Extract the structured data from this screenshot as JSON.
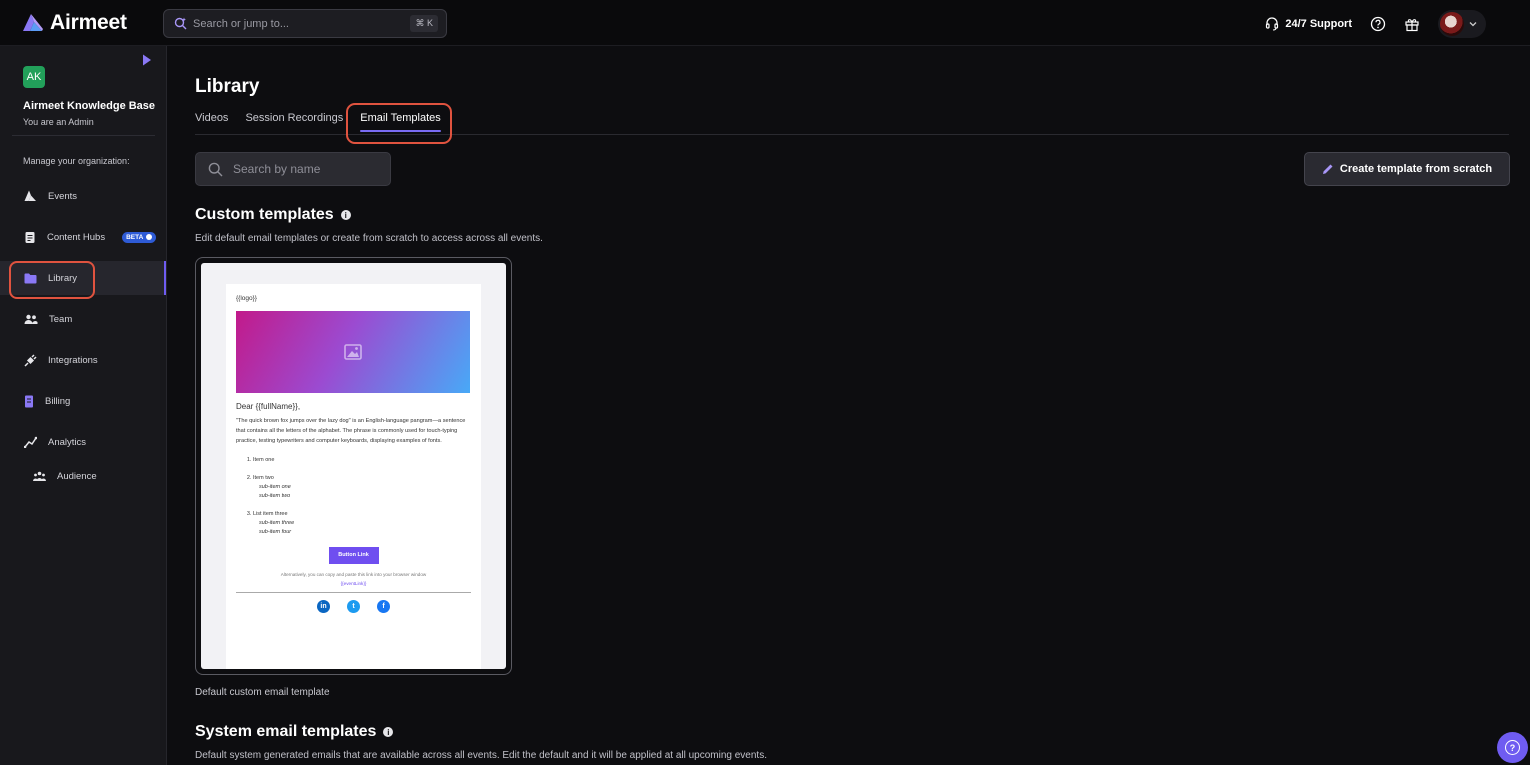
{
  "topbar": {
    "brand": "Airmeet",
    "search_placeholder": "Search or jump to...",
    "shortcut": "⌘ K",
    "support_label": "24/7 Support"
  },
  "sidebar": {
    "org_initials": "AK",
    "org_name": "Airmeet Knowledge Base",
    "org_role": "You are an Admin",
    "manage_label": "Manage your organization:",
    "items": [
      {
        "label": "Events",
        "icon": "airmeet-logo-icon"
      },
      {
        "label": "Content Hubs",
        "icon": "document-icon",
        "badge": "BETA"
      },
      {
        "label": "Library",
        "icon": "folder-icon",
        "active": true
      },
      {
        "label": "Team",
        "icon": "people-icon"
      },
      {
        "label": "Integrations",
        "icon": "plug-icon"
      },
      {
        "label": "Billing",
        "icon": "billing-icon"
      },
      {
        "label": "Analytics",
        "icon": "analytics-icon"
      },
      {
        "label": "Audience",
        "icon": "audience-icon"
      }
    ]
  },
  "main": {
    "title": "Library",
    "tabs": [
      {
        "label": "Videos"
      },
      {
        "label": "Session Recordings"
      },
      {
        "label": "Email Templates",
        "active": true
      }
    ],
    "search_placeholder": "Search by name",
    "create_button": "Create template from scratch",
    "custom_section": {
      "title": "Custom templates",
      "description": "Edit default email templates or create from scratch to access across all events.",
      "template_caption": "Default custom email template"
    },
    "system_section": {
      "title": "System email templates",
      "description": "Default system generated emails that are available across all events. Edit the default and it will be applied at all upcoming events."
    }
  },
  "email_preview": {
    "logo_tag": "{{logo}}",
    "greeting": "Dear {{fullName}},",
    "paragraph": "\"The quick brown fox jumps over the lazy dog\" is an English-language pangram—a sentence that contains all the letters of the alphabet. The phrase is commonly used for touch-typing practice, testing typewriters and computer keyboards, displaying examples of fonts.",
    "list": [
      {
        "text": "Item one",
        "subs": []
      },
      {
        "text": "Item two",
        "subs": [
          "sub-item one",
          "sub-item two"
        ]
      },
      {
        "text": "List item three",
        "subs": [
          "sub-item three",
          "sub-item four"
        ]
      }
    ],
    "button_label": "Button Link",
    "alt_text": "Alternatively, you can copy and paste this link into your browser window",
    "event_link": "{{eventLink}}"
  },
  "colors": {
    "accent": "#6f5cf1",
    "highlight": "#e0533f",
    "background": "#0d0d10",
    "sidebar": "#18181c"
  }
}
